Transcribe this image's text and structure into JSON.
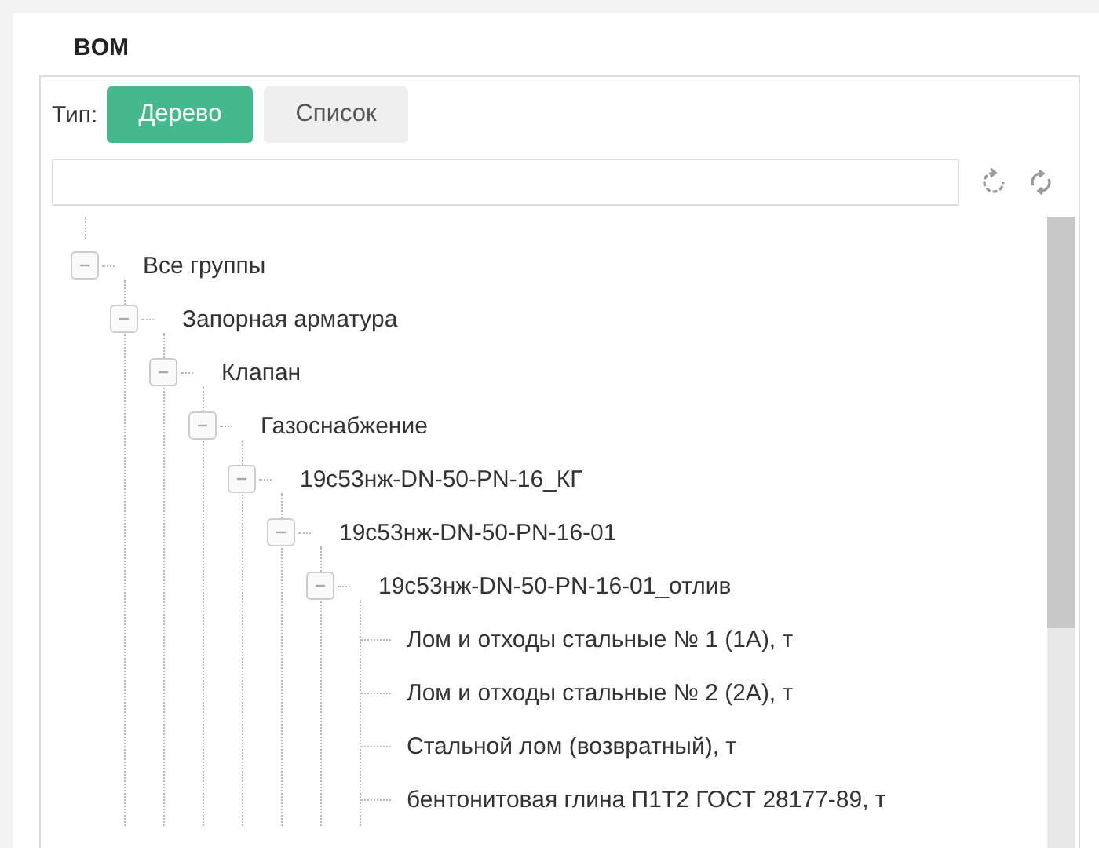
{
  "title": "BOM",
  "type_label": "Тип:",
  "tabs": [
    {
      "label": "Дерево",
      "selected": true
    },
    {
      "label": "Список",
      "selected": false
    }
  ],
  "tree": [
    {
      "label": "Все группы",
      "expanded": true,
      "children": [
        {
          "label": "Запорная арматура",
          "expanded": true,
          "children": [
            {
              "label": "Клапан",
              "expanded": true,
              "children": [
                {
                  "label": "Газоснабжение",
                  "expanded": true,
                  "children": [
                    {
                      "label": "19с53нж-DN-50-PN-16_КГ",
                      "expanded": true,
                      "children": [
                        {
                          "label": "19с53нж-DN-50-PN-16-01",
                          "expanded": true,
                          "children": [
                            {
                              "label": "19с53нж-DN-50-PN-16-01_отлив",
                              "expanded": true,
                              "children": [
                                {
                                  "label": "Лом и отходы стальные № 1 (1А), т"
                                },
                                {
                                  "label": "Лом и отходы стальные № 2 (2А), т"
                                },
                                {
                                  "label": "Стальной лом (возвратный), т"
                                },
                                {
                                  "label": "бентонитовая глина П1Т2 ГОСТ 28177-89, т"
                                }
                              ]
                            }
                          ]
                        }
                      ]
                    }
                  ]
                }
              ]
            }
          ]
        }
      ]
    }
  ]
}
